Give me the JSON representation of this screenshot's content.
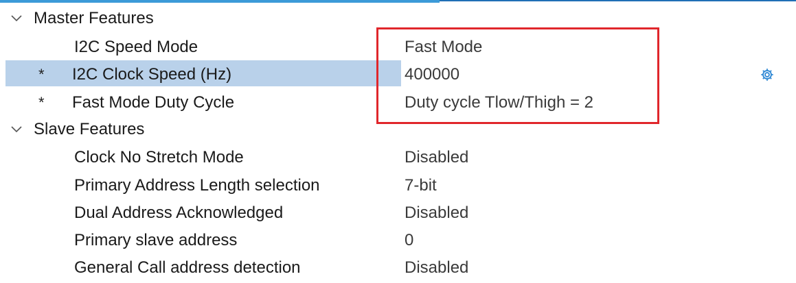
{
  "colors": {
    "selection": "#b9d1ea",
    "highlight_box": "#e0262b",
    "gear_icon": "#2f88d4"
  },
  "groups": {
    "master": {
      "label": "Master Features",
      "icon": "chevron-down-icon",
      "items": [
        {
          "modified": "",
          "label": "I2C Speed Mode",
          "value": "Fast Mode"
        },
        {
          "modified": "*",
          "label": "I2C Clock Speed (Hz)",
          "value": "400000",
          "selected": true,
          "icon": "gear-icon"
        },
        {
          "modified": "*",
          "label": "Fast Mode Duty Cycle",
          "value": "Duty cycle Tlow/Thigh = 2"
        }
      ]
    },
    "slave": {
      "label": "Slave Features",
      "icon": "chevron-down-icon",
      "items": [
        {
          "label": "Clock No Stretch Mode",
          "value": "Disabled"
        },
        {
          "label": "Primary Address Length selection",
          "value": "7-bit"
        },
        {
          "label": "Dual Address Acknowledged",
          "value": "Disabled"
        },
        {
          "label": "Primary slave address",
          "value": "0"
        },
        {
          "label": "General Call address detection",
          "value": "Disabled"
        }
      ]
    }
  }
}
